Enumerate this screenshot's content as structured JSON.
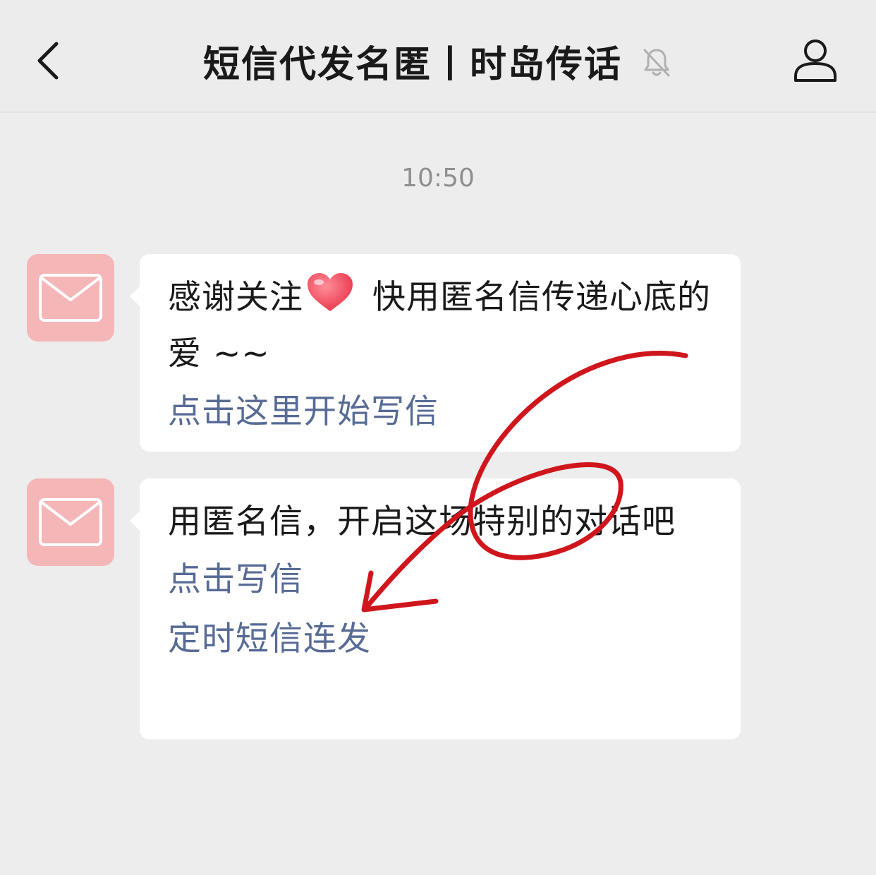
{
  "header": {
    "title": "短信代发名匿丨时岛传话",
    "back_icon": "chevron-left-icon",
    "mute_icon": "bell-muted-icon",
    "profile_icon": "person-icon"
  },
  "chat": {
    "timestamp": "10:50",
    "messages": [
      {
        "avatar_icon": "envelope-icon",
        "text_before_emoji": "感谢关注",
        "emoji": "heart-emoji",
        "text_after_emoji": " 快用匿名信传递心底的爱 ~~",
        "links": [
          "点击这里开始写信"
        ]
      },
      {
        "avatar_icon": "envelope-icon",
        "text": "用匿名信，开启这场特别的对话吧",
        "links": [
          "点击写信",
          "定时短信连发"
        ]
      }
    ]
  },
  "colors": {
    "background": "#ededed",
    "avatar_bg": "#f5b6b8",
    "link": "#576b95",
    "annotation": "#d0161d"
  }
}
